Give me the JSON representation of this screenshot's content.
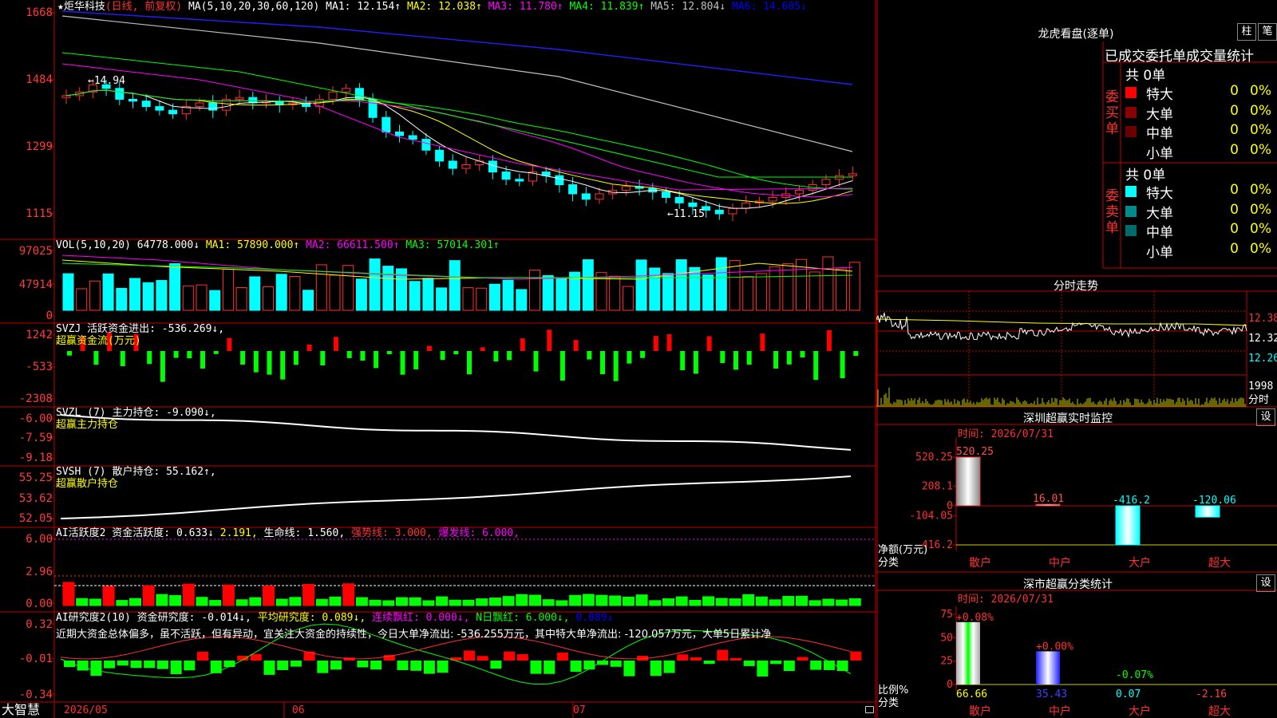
{
  "main": {
    "title": "★炬华科技",
    "period": "(日线, 前复权)",
    "ma_label": "MA(5,10,20,30,60,120)",
    "ma": [
      {
        "name": "MA1",
        "value": "12.154↑",
        "color": "#ffffff"
      },
      {
        "name": "MA2",
        "value": "12.038↑",
        "color": "#ffff00"
      },
      {
        "name": "MA3",
        "value": "11.780↑",
        "color": "#ff00ff"
      },
      {
        "name": "MA4",
        "value": "11.839↑",
        "color": "#00ff00"
      },
      {
        "name": "MA5",
        "value": "12.804↓",
        "color": "#c0c0c0"
      },
      {
        "name": "MA6",
        "value": "14.605↓",
        "color": "#0000ff"
      }
    ],
    "y_ticks": [
      "1668",
      "1484",
      "1299",
      "1115"
    ],
    "high_label": "←14.94",
    "low_label": "←11.15"
  },
  "vol": {
    "label": "VOL(5,10,20)",
    "value": "64778.000↓",
    "ma1": "MA1: 57890.000↑",
    "ma2": "MA2: 66611.500↑",
    "ma3": "MA3: 57014.301↑",
    "y_ticks": [
      "97025",
      "47914",
      "0"
    ]
  },
  "svzj": {
    "line1": "SVZJ  活跃资金进出: -536.269↓,",
    "line2": "超赢资金流(万元)",
    "y_ticks": [
      "1242",
      "-533",
      "-2308"
    ]
  },
  "svzl": {
    "line1": "SVZL (7) 主力持仓: -9.090↓,",
    "line2": "超赢主力持仓",
    "y_ticks": [
      "-6.00",
      "-7.59",
      "-9.18"
    ]
  },
  "svsh": {
    "line1": "SVSH (7) 散户持仓: 55.162↑,",
    "line2": "超赢散户持仓",
    "y_ticks": [
      "55.25",
      "53.62",
      "52.05"
    ]
  },
  "ai1": {
    "label": "AI活跃度2 资金活跃度: 0.633↓",
    "v2": "2.191,",
    "v3": "生命线: 1.560,",
    "v4": "强势线: 3.000,",
    "v5": "爆发线: 6.000,",
    "y_ticks": [
      "6.00",
      "2.96",
      "0.00"
    ]
  },
  "ai2": {
    "label": "AI研究度2(10) 资金研究度: -0.014↓,",
    "v2": "平均研究度: 0.089↓,",
    "v3": "连续飘红: 0.000↓,",
    "v4": "N日飘红: 6.000↓,",
    "v5": "0.089↓",
    "comment": "近期大资金总体偏多，虽不活跃，但有异动，宜关注大资金的持续性，今日大单净流出: -536.255万元，其中特大单净流出: -120.057万元，大单5日累计净",
    "y_ticks": [
      "0.32",
      "-0.01",
      "-0.34"
    ]
  },
  "bottom": {
    "brand": "大智慧",
    "dates": [
      "2026/05",
      "06",
      "07"
    ]
  },
  "right": {
    "dragon_title": "龙虎看盘(逐单)",
    "btn_zhu": "柱",
    "btn_bi": "笔",
    "stat_title": "已成交委托单成交量统计",
    "buy_label": "委买单",
    "sell_label": "委卖单",
    "buy_total": "共 0单",
    "sell_total": "共 0单",
    "buy_rows": [
      {
        "name": "特大",
        "count": "0",
        "pct": "0%",
        "color": "#ff0000"
      },
      {
        "name": "大单",
        "count": "0",
        "pct": "0%",
        "color": "#8b0000"
      },
      {
        "name": "中单",
        "count": "0",
        "pct": "0%",
        "color": "#6b0000"
      },
      {
        "name": "小单",
        "count": "0",
        "pct": "0%",
        "color": ""
      }
    ],
    "sell_rows": [
      {
        "name": "特大",
        "count": "0",
        "pct": "0%",
        "color": "#00ffff"
      },
      {
        "name": "大单",
        "count": "0",
        "pct": "0%",
        "color": "#008b8b"
      },
      {
        "name": "中单",
        "count": "0",
        "pct": "0%",
        "color": "#006b6b"
      },
      {
        "name": "小单",
        "count": "0",
        "pct": "0%",
        "color": ""
      }
    ],
    "intraday_title": "分时走势",
    "intraday_prices": [
      "12.38",
      "12.32",
      "12.26"
    ],
    "intraday_vol": "1998",
    "intraday_unit": "分时",
    "sz_title": "深圳超赢实时监控",
    "sz_set": "设",
    "sz_time": "时间: 2026/07/31",
    "sz_yticks": [
      "520.25",
      "208.1",
      "0",
      "-104.05",
      "-416.2"
    ],
    "sz_values": [
      {
        "label": "520.25",
        "value": 520.25,
        "color": "#ff5050"
      },
      {
        "label": "16.01",
        "value": 16.01,
        "color": "#ff5050"
      },
      {
        "label": "-416.2",
        "value": -416.2,
        "color": "#00ffff"
      },
      {
        "label": "-120.06",
        "value": -120.06,
        "color": "#00ffff"
      }
    ],
    "sz_ylabel1": "净额(万元)",
    "sz_ylabel2": "分类",
    "categories": [
      "散户",
      "中户",
      "大户",
      "超大"
    ],
    "fl_title": "深市超赢分类统计",
    "fl_set": "设",
    "fl_time": "时间: 2026/07/31",
    "fl_yticks": [
      "75",
      "50",
      "25",
      "0"
    ],
    "fl_top_labels": [
      "+0.08%",
      "+0.00%",
      "-0.07%",
      ""
    ],
    "fl_values": [
      {
        "label": "66.66",
        "value": 66.66,
        "color": "#ffff00"
      },
      {
        "label": "35.43",
        "value": 35.43,
        "color": "#4040ff"
      },
      {
        "label": "0.07",
        "value": 0.07,
        "color": "#00ffff"
      },
      {
        "label": "-2.16",
        "value": -2.16,
        "color": "#ff4040"
      }
    ],
    "fl_ylabel1": "比例%",
    "fl_ylabel2": "分类"
  }
}
